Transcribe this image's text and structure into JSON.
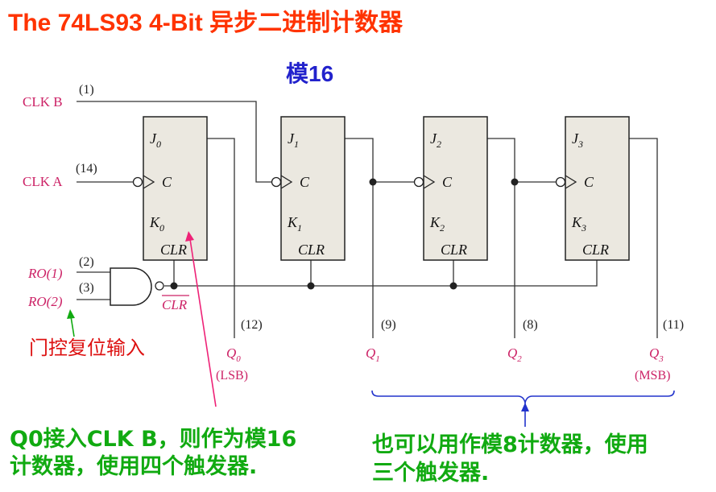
{
  "title": "The 74LS93 4-Bit 异步二进制计数器",
  "subtitle": "模16",
  "inputs": {
    "clk_b": {
      "label": "CLK  B",
      "pin": "(1)"
    },
    "clk_a": {
      "label": "CLK  A",
      "pin": "(14)"
    },
    "ro1": {
      "label": "RO(1)",
      "pin": "(2)"
    },
    "ro2": {
      "label": "RO(2)",
      "pin": "(3)"
    }
  },
  "reset_bar": "CLR",
  "flip_flops": [
    {
      "j": "J",
      "k": "K",
      "index": "0",
      "c": "C",
      "clr": "CLR"
    },
    {
      "j": "J",
      "k": "K",
      "index": "1",
      "c": "C",
      "clr": "CLR"
    },
    {
      "j": "J",
      "k": "K",
      "index": "2",
      "c": "C",
      "clr": "CLR"
    },
    {
      "j": "J",
      "k": "K",
      "index": "3",
      "c": "C",
      "clr": "CLR"
    }
  ],
  "outputs": [
    {
      "label": "Q",
      "index": "0",
      "pin": "(12)",
      "note": "(LSB)"
    },
    {
      "label": "Q",
      "index": "1",
      "pin": "(9)",
      "note": ""
    },
    {
      "label": "Q",
      "index": "2",
      "pin": "(8)",
      "note": ""
    },
    {
      "label": "Q",
      "index": "3",
      "pin": "(11)",
      "note": "(MSB)"
    }
  ],
  "annotations": {
    "gated_reset": "门控复位输入",
    "mod16_line1": "Q0接入CLK B，则作为模16",
    "mod16_line2": "计数器，使用四个触发器.",
    "mod8_line1": "也可以用作模8计数器，使用",
    "mod8_line2": "三个触发器."
  },
  "colors": {
    "title": "#ff3300",
    "subtitle": "#2222cc",
    "signal": "#cc2266",
    "annotation_red": "#dd1111",
    "annotation_green": "#11aa11",
    "brace": "#2233cc",
    "flip_flop_fill": "#ebe8e0"
  }
}
